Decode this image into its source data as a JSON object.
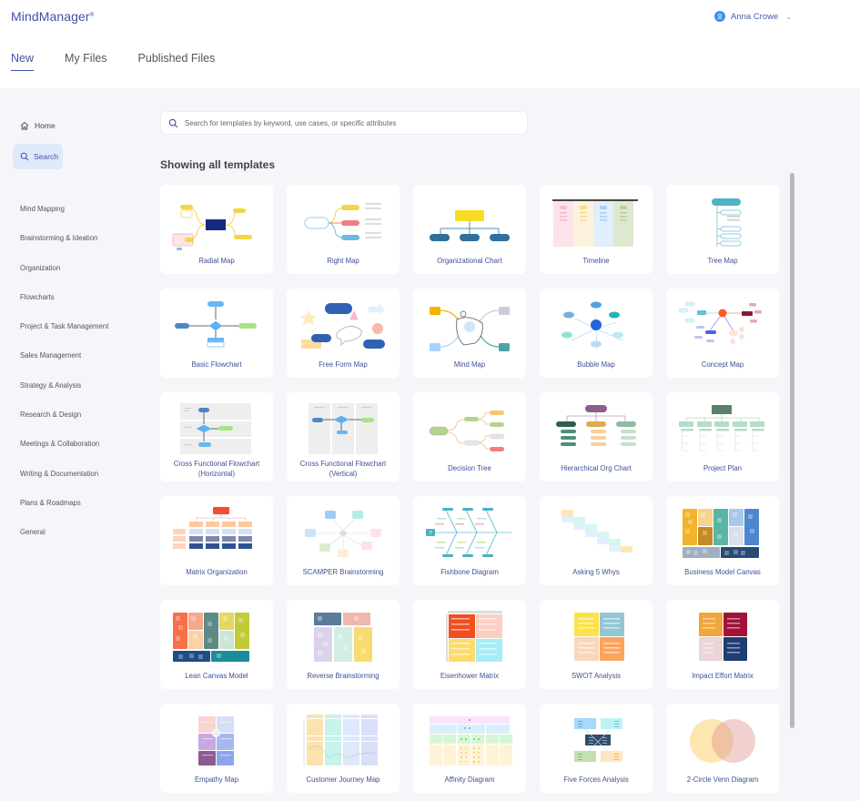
{
  "app": {
    "logo": "MindManager",
    "logo_mark": "®"
  },
  "user": {
    "name": "Anna Crowe",
    "avatar_icon": "user-icon",
    "menu_icon": "chevron-down-icon"
  },
  "tabs": [
    {
      "label": "New",
      "active": true
    },
    {
      "label": "My Files",
      "active": false
    },
    {
      "label": "Published Files",
      "active": false
    }
  ],
  "sidebar": {
    "home": {
      "label": "Home",
      "icon": "home-icon"
    },
    "search": {
      "label": "Search",
      "icon": "search-icon",
      "active": true
    },
    "categories": [
      "Mind Mapping",
      "Brainstorming & Ideation",
      "Organization",
      "Flowcharts",
      "Project & Task Management",
      "Sales Management",
      "Strategy & Analysis",
      "Research & Design",
      "Meetings & Collaboration",
      "Writing & Documentation",
      "Plans & Roadmaps",
      "General"
    ]
  },
  "search": {
    "placeholder": "Search for templates by keyword, use cases, or specific attributes",
    "value": ""
  },
  "heading": "Showing all templates",
  "templates": [
    {
      "label": "Radial Map"
    },
    {
      "label": "Right Map"
    },
    {
      "label": "Organizational Chart"
    },
    {
      "label": "Timeline"
    },
    {
      "label": "Tree Map"
    },
    {
      "label": "Basic Flowchart"
    },
    {
      "label": "Free Form Map"
    },
    {
      "label": "Mind Map"
    },
    {
      "label": "Bubble Map"
    },
    {
      "label": "Concept Map"
    },
    {
      "label": "Cross Functional Flowchart",
      "sub": "(Horizontal)"
    },
    {
      "label": "Cross Functional Flowchart",
      "sub": "(Vertical)"
    },
    {
      "label": "Decision Tree"
    },
    {
      "label": "Hierarchical Org Chart"
    },
    {
      "label": "Project Plan"
    },
    {
      "label": "Matrix Organization"
    },
    {
      "label": "SCAMPER Brainstorming"
    },
    {
      "label": "Fishbone Diagram"
    },
    {
      "label": "Asking 5 Whys"
    },
    {
      "label": "Business Model Canvas"
    },
    {
      "label": "Lean Canvas Model"
    },
    {
      "label": "Reverse Brainstorming"
    },
    {
      "label": "Eisenhower Matrix"
    },
    {
      "label": "SWOT Analysis"
    },
    {
      "label": "Impact Effort Matrix"
    },
    {
      "label": "Empathy Map"
    },
    {
      "label": "Customer Journey Map"
    },
    {
      "label": "Affinity Diagram"
    },
    {
      "label": "Five Forces Analysis"
    },
    {
      "label": "2-Circle Venn Diagram"
    }
  ],
  "colors": {
    "accent": "#3f51a8",
    "active_bg": "#dfe9fb",
    "page_bg": "#f6f6fa"
  }
}
